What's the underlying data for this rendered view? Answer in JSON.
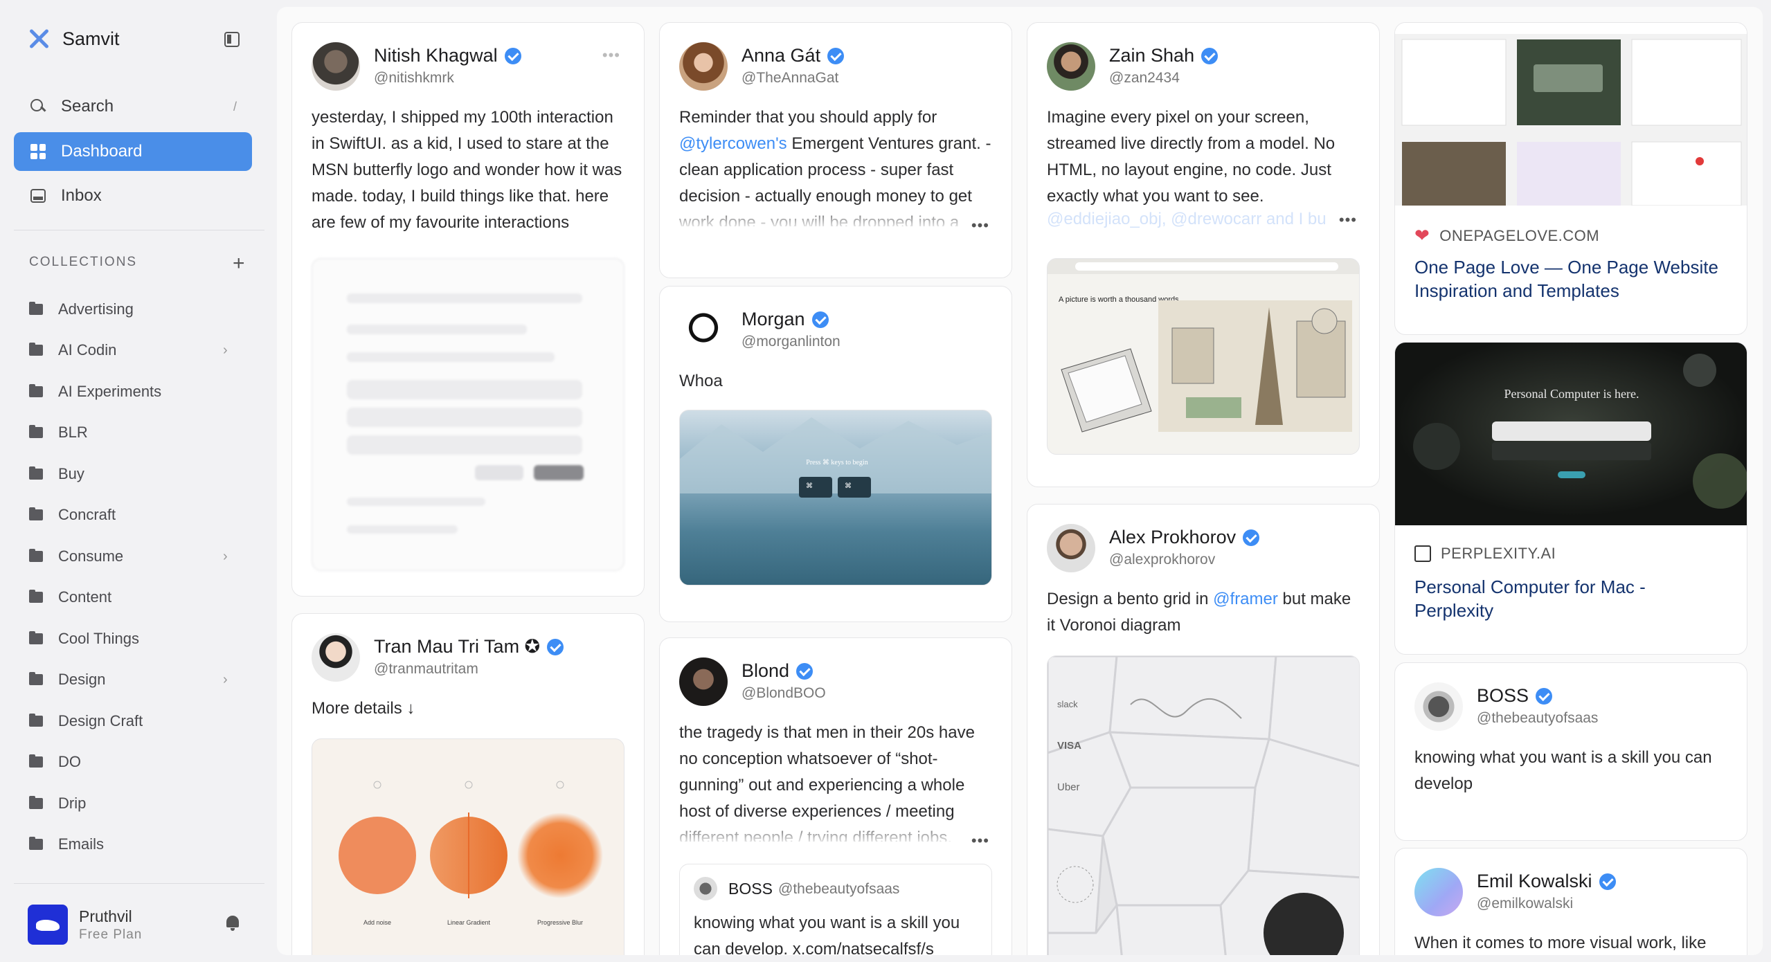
{
  "app": {
    "name": "Samvit"
  },
  "nav": {
    "search_label": "Search",
    "search_shortcut": "/",
    "dashboard_label": "Dashboard",
    "inbox_label": "Inbox"
  },
  "collections": {
    "heading": "COLLECTIONS",
    "add_label": "+",
    "items": [
      "Advertising",
      "AI Codin",
      "AI Experiments",
      "BLR",
      "Buy",
      "Concraft",
      "Consume",
      "Content",
      "Cool Things",
      "Design",
      "Design Craft",
      "DO",
      "Drip",
      "Emails"
    ]
  },
  "user": {
    "name": "Pruthvil",
    "plan": "Free Plan"
  },
  "posts": [
    {
      "name": "Nitish Khagwal",
      "handle": "@nitishkmrk",
      "text": "yesterday, I shipped my 100th interaction in SwiftUI. as a kid, I used to stare at the MSN butterfly logo and wonder how it was made. today, I build things like that. here are few of my favourite interactions"
    },
    {
      "name": "Tran Mau Tri Tam ✪",
      "handle": "@tranmautritam",
      "text": "More details ↓",
      "media_labels": [
        "Add noise",
        "Linear Gradient",
        "Progressive Blur"
      ]
    },
    {
      "name": "Anna Gát",
      "handle": "@TheAnnaGat",
      "text_before": "Reminder that you should apply for ",
      "link": "@tylercowen's",
      "text_after": " Emergent Ventures grant. - clean application process - super fast decision - actually enough money to get work done - you will be dropped into a"
    },
    {
      "name": "Morgan",
      "handle": "@morganlinton",
      "text": "Whoa",
      "media_caption": "Press ⌘ keys to begin"
    },
    {
      "name": "Blond",
      "handle": "@BlondBOO",
      "text": "the tragedy is that men in their 20s have no conception whatsoever of “shot-gunning” out and experiencing a whole host of diverse experiences / meeting different people / trying different jobs,",
      "quote_name": "BOSS",
      "quote_handle": "@thebeautyofsaas",
      "quote_text": "knowing what you want is a skill you can develop. x.com/natsecalfsf/s"
    },
    {
      "name": "Zain Shah",
      "handle": "@zan2434",
      "text": "Imagine every pixel on your screen, streamed live directly from a model. No HTML, no layout engine, no code. Just exactly what you want to see.",
      "fade_text": "@eddiejiao_obj, @drewocarr and I bu",
      "media_heading": "A picture is worth a thousand words"
    },
    {
      "name": "Alex Prokhorov",
      "handle": "@alexprokhorov",
      "text_before": "Design a bento grid in ",
      "link": "@framer",
      "text_after": " but make it Voronoi diagram",
      "media_labels": [
        "slack",
        "VISA",
        "Uber"
      ]
    },
    {
      "name": "BOSS",
      "handle": "@thebeautyofsaas",
      "text": "knowing what you want is a skill you can develop"
    },
    {
      "name": "Emil Kowalski",
      "handle": "@emilkowalski",
      "text": "When it comes to more visual work, like"
    }
  ],
  "links": [
    {
      "site": "ONEPAGELOVE.COM",
      "title": "One Page Love — One Page Website Inspiration and Templates"
    },
    {
      "site": "PERPLEXITY.AI",
      "title": "Personal Computer for Mac - Perplexity",
      "shot_heading": "Personal Computer is here."
    }
  ],
  "colors": {
    "accent": "#4a8ee8",
    "verified": "#3d8df5",
    "link_title": "#14336e"
  }
}
